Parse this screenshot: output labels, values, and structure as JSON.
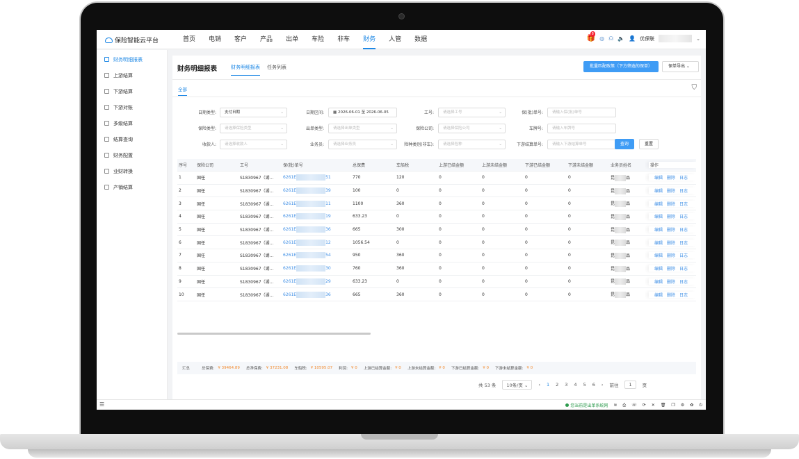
{
  "app": {
    "brand": "保险智能云平台"
  },
  "nav": {
    "items": [
      "首页",
      "电销",
      "客户",
      "产品",
      "出单",
      "车险",
      "非车",
      "财务",
      "人管",
      "数据"
    ],
    "active_index": 7
  },
  "topbar": {
    "badge_count": "8",
    "user_prefix": "优保联"
  },
  "sidebar": {
    "items": [
      {
        "label": "财务明细报表",
        "active": true
      },
      {
        "label": "上游结算"
      },
      {
        "label": "下游结算"
      },
      {
        "label": "下游对账"
      },
      {
        "label": "多级结算"
      },
      {
        "label": "结算查询"
      },
      {
        "label": "财务配置"
      },
      {
        "label": "业财转换"
      },
      {
        "label": "产销结算"
      }
    ]
  },
  "page": {
    "title": "财务明细报表",
    "tabs": [
      "财务明细报表",
      "任务列表"
    ],
    "primary_button": "批量匹配政策（下方筛选的保单）",
    "export_button": "保单导出",
    "sub_tab": "全部"
  },
  "filters": {
    "date_type_label": "日期类型:",
    "date_type_value": "支付日期",
    "date_range_label": "日期区间:",
    "date_start": "2026-06-01",
    "date_end": "2026-06-05",
    "job_label": "工号:",
    "job_placeholder": "请选择工号",
    "policy_label": "保(批)单号:",
    "policy_placeholder": "请输入保(批)单号",
    "ins_type_label": "保险类型:",
    "ins_type_placeholder": "请选择保险类型",
    "issue_type_label": "出单类型:",
    "issue_type_placeholder": "请选择出单类型",
    "company_label": "保险公司:",
    "company_placeholder": "请选择保险公司",
    "plate_label": "车牌号:",
    "plate_placeholder": "请输入车牌号",
    "payee_label": "收款人:",
    "payee_placeholder": "请选择收款人",
    "salesman_label": "业务员:",
    "salesman_placeholder": "请选择业务员",
    "risk_label": "险种类别(非车):",
    "risk_placeholder": "请选择险种",
    "settle_label": "下游结算单号:",
    "settle_placeholder": "请输入下游结算单号",
    "query_button": "查询",
    "reset_button": "重置"
  },
  "table": {
    "headers": [
      "序号",
      "保险公司",
      "工号",
      "保(批)单号",
      "总保费",
      "车船税",
      "上游已结金额",
      "上游未结金额",
      "下游已结金额",
      "下游未结金额",
      "业务员姓名",
      "操作"
    ],
    "ops": [
      "编辑",
      "删除",
      "日志"
    ],
    "rows": [
      {
        "no": "1",
        "company": "国任",
        "job": "S1830967（湖...",
        "policy_a": "6261E",
        "policy_b": "51",
        "premium": "770",
        "tax": "120",
        "c1": "0",
        "c2": "0",
        "c3": "0",
        "c4": "0",
        "sp": "昆",
        "ss": "品"
      },
      {
        "no": "2",
        "company": "国任",
        "job": "S1830967（湖...",
        "policy_a": "6261E",
        "policy_b": "39",
        "premium": "100",
        "tax": "0",
        "c1": "0",
        "c2": "0",
        "c3": "0",
        "c4": "0",
        "sp": "昆",
        "ss": "品"
      },
      {
        "no": "3",
        "company": "国任",
        "job": "S1830967（湖...",
        "policy_a": "6261E",
        "policy_b": "11",
        "premium": "1100",
        "tax": "360",
        "c1": "0",
        "c2": "0",
        "c3": "0",
        "c4": "0",
        "sp": "昆",
        "ss": "品"
      },
      {
        "no": "4",
        "company": "国任",
        "job": "S1830967（湖...",
        "policy_a": "6261E",
        "policy_b": "19",
        "premium": "633.23",
        "tax": "0",
        "c1": "0",
        "c2": "0",
        "c3": "0",
        "c4": "0",
        "sp": "昆",
        "ss": "品"
      },
      {
        "no": "5",
        "company": "国任",
        "job": "S1830967（湖...",
        "policy_a": "6261E",
        "policy_b": "36",
        "premium": "665",
        "tax": "300",
        "c1": "0",
        "c2": "0",
        "c3": "0",
        "c4": "0",
        "sp": "昆",
        "ss": "品"
      },
      {
        "no": "6",
        "company": "国任",
        "job": "S1830967（湖...",
        "policy_a": "6261E",
        "policy_b": "12",
        "premium": "1056.54",
        "tax": "0",
        "c1": "0",
        "c2": "0",
        "c3": "0",
        "c4": "0",
        "sp": "昆",
        "ss": "品"
      },
      {
        "no": "7",
        "company": "国任",
        "job": "S1830967（湖...",
        "policy_a": "6261E",
        "policy_b": "54",
        "premium": "950",
        "tax": "360",
        "c1": "0",
        "c2": "0",
        "c3": "0",
        "c4": "0",
        "sp": "昆",
        "ss": "品"
      },
      {
        "no": "8",
        "company": "国任",
        "job": "S1830967（湖...",
        "policy_a": "6261E",
        "policy_b": "30",
        "premium": "760",
        "tax": "360",
        "c1": "0",
        "c2": "0",
        "c3": "0",
        "c4": "0",
        "sp": "昆",
        "ss": "品"
      },
      {
        "no": "9",
        "company": "国任",
        "job": "S1830967（湖...",
        "policy_a": "6261E",
        "policy_b": "29",
        "premium": "633.23",
        "tax": "0",
        "c1": "0",
        "c2": "0",
        "c3": "0",
        "c4": "0",
        "sp": "昆",
        "ss": "品"
      },
      {
        "no": "10",
        "company": "国任",
        "job": "S1830967（湖...",
        "policy_a": "6261E",
        "policy_b": "36",
        "premium": "665",
        "tax": "360",
        "c1": "0",
        "c2": "0",
        "c3": "0",
        "c4": "0",
        "sp": "昆",
        "ss": "品"
      }
    ]
  },
  "summary": {
    "label": "汇总",
    "items": [
      {
        "label": "总保费:",
        "value": "¥ 39464.89"
      },
      {
        "label": "总净保费:",
        "value": "¥ 37231.08"
      },
      {
        "label": "车船税:",
        "value": "¥ 10595.07"
      },
      {
        "label": "利润:",
        "value": "¥ 0"
      },
      {
        "label": "上游已结算金额:",
        "value": "¥ 0"
      },
      {
        "label": "上游未结算金额:",
        "value": "¥ 0"
      },
      {
        "label": "下游已结算金额:",
        "value": "¥ 0"
      },
      {
        "label": "下游未结算金额:",
        "value": "¥ 0"
      }
    ]
  },
  "pagination": {
    "total": "共 53 条",
    "page_size": "10条/页",
    "pages": [
      "1",
      "2",
      "3",
      "4",
      "5",
      "6"
    ],
    "active_page": "1",
    "goto_label": "前往",
    "goto_value": "1",
    "page_unit": "页"
  },
  "statusbar": {
    "text": "您当前是出单系统网"
  },
  "colors": {
    "accent": "#1e88e5",
    "primary_button": "#3f9cf5",
    "money": "#f28a2e",
    "status_ok": "#2e9b4e"
  }
}
